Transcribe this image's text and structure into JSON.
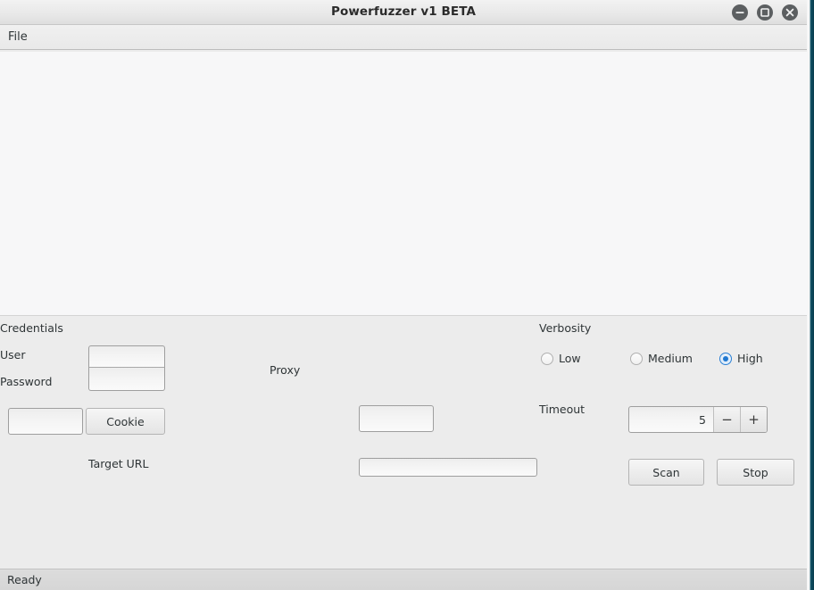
{
  "window": {
    "title": "Powerfuzzer v1 BETA",
    "controls": [
      {
        "name": "minimize-button",
        "glyph": "minimize-icon"
      },
      {
        "name": "maximize-button",
        "glyph": "maximize-icon"
      },
      {
        "name": "close-button",
        "glyph": "close-icon"
      }
    ]
  },
  "menubar": {
    "items": [
      {
        "label": "File"
      }
    ]
  },
  "output": {
    "text": ""
  },
  "credentials": {
    "group_label": "Credentials",
    "user_label": "User",
    "user_value": "",
    "user_placeholder": "",
    "password_label": "Password",
    "password_value": "",
    "password_placeholder": "",
    "cookie_value": "",
    "cookie_placeholder": "",
    "cookie_button_label": "Cookie"
  },
  "target": {
    "url_label": "Target URL",
    "url_value": "",
    "url_placeholder": ""
  },
  "proxy": {
    "label": "Proxy",
    "value": "",
    "placeholder": ""
  },
  "verbosity": {
    "group_label": "Verbosity",
    "options": [
      {
        "label": "Low",
        "selected": false
      },
      {
        "label": "Medium",
        "selected": false
      },
      {
        "label": "High",
        "selected": true
      }
    ],
    "selected_value": "High"
  },
  "timeout": {
    "label": "Timeout",
    "value": "5",
    "decrement_label": "−",
    "increment_label": "+"
  },
  "actions": {
    "scan_label": "Scan",
    "stop_label": "Stop"
  },
  "statusbar": {
    "text": "Ready"
  },
  "colors": {
    "accent": "#1f78d1",
    "window_bg": "#ececec",
    "output_bg": "#f7f7f8",
    "edge_strip": "#0d4f63",
    "statusbar_bg": "#d6d6d6"
  }
}
